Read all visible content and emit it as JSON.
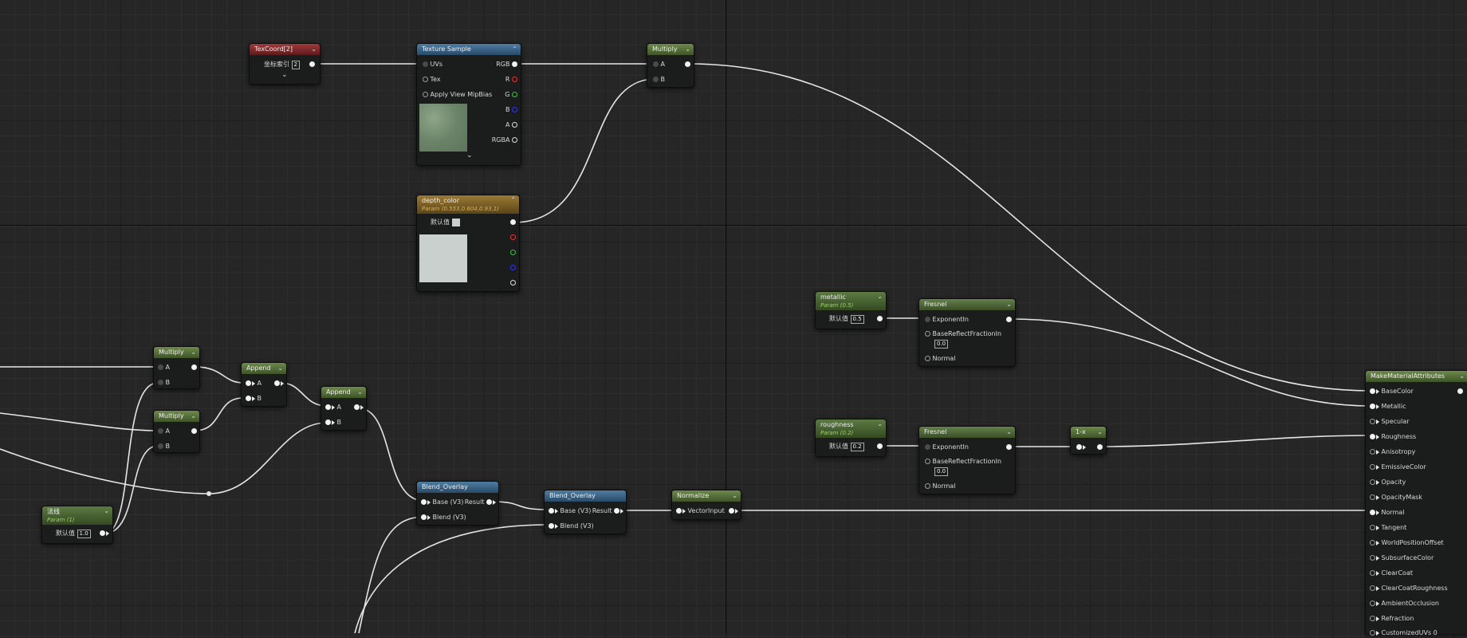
{
  "nodes": {
    "texcoord": {
      "title": "TexCoord[2]",
      "index_label": "坐标索引",
      "index_value": "2"
    },
    "texture_sample": {
      "title": "Texture Sample",
      "uvs": "UVs",
      "tex": "Tex",
      "mip": "Apply View MipBias",
      "rgb": "RGB",
      "r": "R",
      "g": "G",
      "b": "B",
      "a": "A",
      "rgba": "RGBA"
    },
    "multiply_top": {
      "title": "Multiply",
      "a": "A",
      "b": "B"
    },
    "depth_color": {
      "title": "depth_color",
      "subtitle": "Param (0.553,0.604,0.93,1)",
      "default_label": "默认值"
    },
    "metallic": {
      "title": "metallic",
      "subtitle": "Param (0.5)",
      "default_label": "默认值",
      "value": "0.5"
    },
    "fresnel1": {
      "title": "Fresnel",
      "exponent": "ExponentIn",
      "base": "BaseReflectFractionIn",
      "base_value": "0.0",
      "normal": "Normal"
    },
    "roughness": {
      "title": "roughness",
      "subtitle": "Param (0.2)",
      "default_label": "默认值",
      "value": "0.2"
    },
    "fresnel2": {
      "title": "Fresnel",
      "exponent": "ExponentIn",
      "base": "BaseReflectFractionIn",
      "base_value": "0.0",
      "normal": "Normal"
    },
    "oneminus": {
      "title": "1-x"
    },
    "multiply1": {
      "title": "Multiply",
      "a": "A",
      "b": "B"
    },
    "multiply2": {
      "title": "Multiply",
      "a": "A",
      "b": "B"
    },
    "append1": {
      "title": "Append",
      "a": "A",
      "b": "B"
    },
    "append2": {
      "title": "Append",
      "a": "A",
      "b": "B"
    },
    "blend1": {
      "title": "Blend_Overlay",
      "base": "Base (V3)",
      "blend": "Blend (V3)",
      "result": "Result"
    },
    "blend2": {
      "title": "Blend_Overlay",
      "base": "Base (V3)",
      "blend": "Blend (V3)",
      "result": "Result"
    },
    "normalize": {
      "title": "Normalize",
      "input": "VectorInput"
    },
    "param_normal": {
      "title": "法线",
      "subtitle": "Param (1)",
      "default_label": "默认值",
      "value": "1.0"
    },
    "make_material": {
      "title": "MakeMaterialAttributes",
      "pins": [
        "BaseColor",
        "Metallic",
        "Specular",
        "Roughness",
        "Anisotropy",
        "EmissiveColor",
        "Opacity",
        "OpacityMask",
        "Normal",
        "Tangent",
        "WorldPositionOffset",
        "SubsurfaceColor",
        "ClearCoat",
        "ClearCoatRoughness",
        "AmbientOcclusion",
        "Refraction",
        "CustomizedUVs 0"
      ]
    }
  },
  "colors": {
    "wire": "#e6e6e6",
    "background": "#262626"
  }
}
